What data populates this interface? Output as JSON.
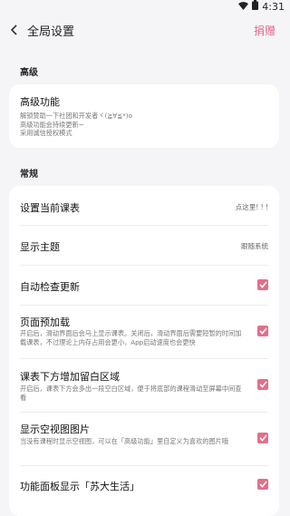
{
  "status": {
    "time": "4:31"
  },
  "header": {
    "title": "全局设置",
    "donate_label": "捐赠"
  },
  "sections": {
    "advanced": "高级",
    "general": "常规"
  },
  "advanced": {
    "title": "高级功能",
    "desc1": "解锁赞助一下社团和开发者ヾ(≧∀≦*)o",
    "desc2": "高级功能会持续更新~",
    "desc3": "采用诚信授权模式"
  },
  "general": {
    "set_timetable": {
      "title": "设置当前课表",
      "value": "点这里! ! !"
    },
    "theme": {
      "title": "显示主题",
      "value": "跟随系统"
    },
    "auto_update": {
      "title": "自动检查更新",
      "checked": true
    },
    "preload": {
      "title": "页面预加载",
      "desc": "开启后，滑动界面后会马上显示课表。关闭后，滑动界面后需要短暂的时间加载课表，不过理论上内存占用会更小，App启动速度也会更快",
      "checked": true
    },
    "bottom_space": {
      "title": "课表下方增加留白区域",
      "desc": "开启后，课表下方会多出一段空白区域，便于将底部的课程滑动至屏幕中间查看",
      "checked": true
    },
    "empty_image": {
      "title": "显示空视图图片",
      "desc": "当没有课程时显示空视图，可以在「高级功能」里自定义为喜欢的图片哦",
      "checked": true
    },
    "su_life": {
      "title": "功能面板显示「苏大生活」",
      "checked": true
    }
  },
  "colors": {
    "accent": "#e36f89",
    "background": "#f5f5f7"
  }
}
